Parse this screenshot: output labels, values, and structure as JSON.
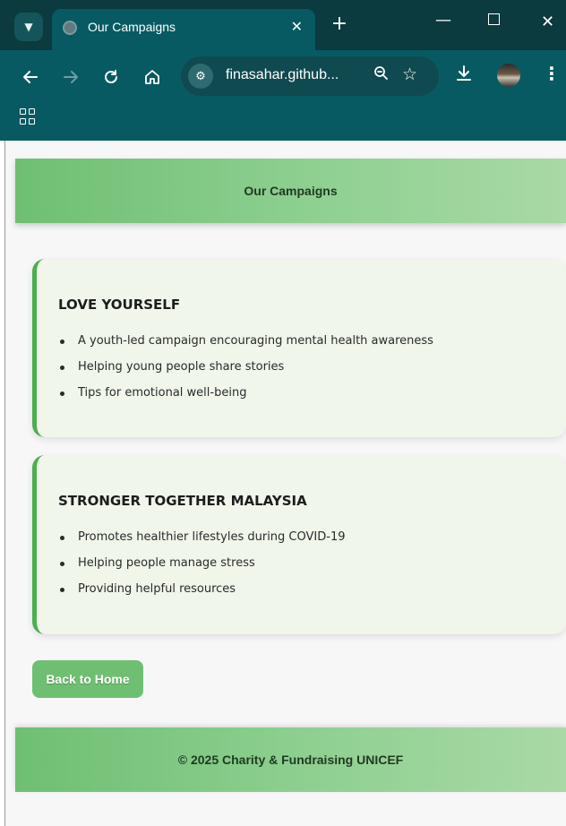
{
  "browser": {
    "tab_title": "Our Campaigns",
    "url": "finasahar.github...",
    "new_tab_label": "+",
    "tab_close_label": "✕",
    "icons": [
      "chevron-down-icon",
      "globe-icon",
      "close-icon",
      "plus-icon",
      "minimize-icon",
      "maximize-icon",
      "window-close-icon",
      "back-arrow-icon",
      "forward-arrow-icon",
      "reload-icon",
      "home-icon",
      "site-info-icon",
      "zoom-icon",
      "star-icon",
      "download-icon",
      "profile-avatar",
      "kebab-menu-icon",
      "apps-grid-icon"
    ]
  },
  "page": {
    "header_title": "Our Campaigns",
    "campaigns": [
      {
        "title": "LOVE YOURSELF",
        "items": [
          "A youth-led campaign encouraging mental health awareness",
          "Helping young people share stories",
          "Tips for emotional well-being"
        ]
      },
      {
        "title": "STRONGER TOGETHER MALAYSIA",
        "items": [
          "Promotes healthier lifestyles during COVID-19",
          "Helping people manage stress",
          "Providing helpful resources"
        ]
      }
    ],
    "back_button_label": "Back to Home",
    "footer_text": "© 2025 Charity & Fundraising UNICEF"
  },
  "colors": {
    "chrome_bg": "#085a62",
    "tabbar_bg": "#0b3a3f",
    "accent_green": "#4caf50",
    "band_green_start": "#6fbf73",
    "band_green_end": "#a9d9a6",
    "card_bg": "#f0f6ea"
  }
}
